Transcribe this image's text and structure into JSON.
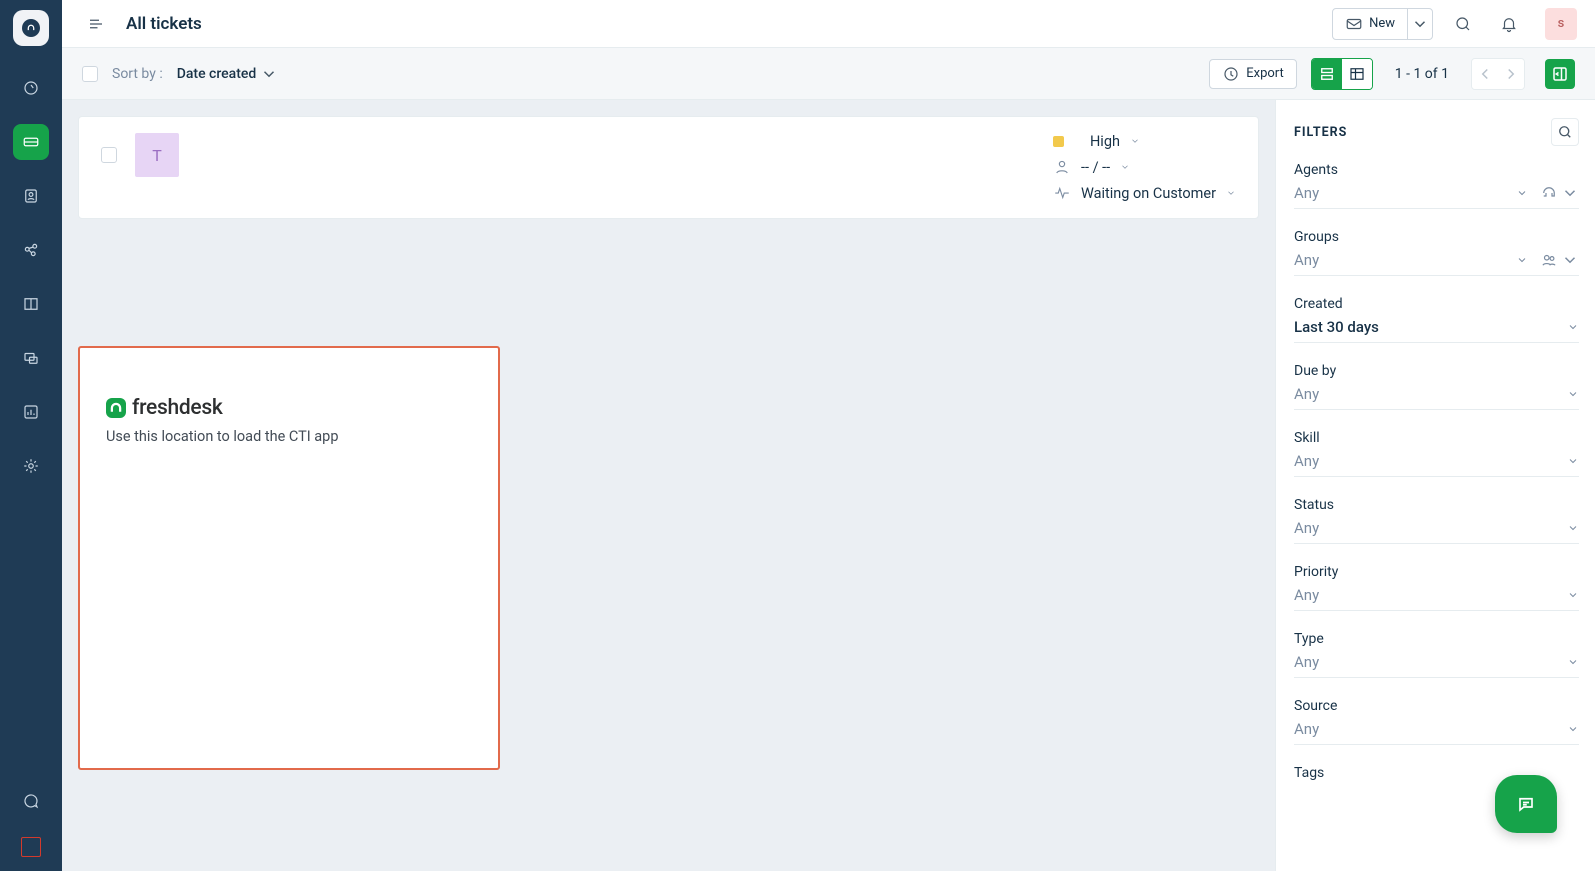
{
  "header": {
    "page_title": "All tickets",
    "new_label": "New",
    "avatar_letter": "s"
  },
  "toolbar": {
    "sort_label": "Sort by :",
    "sort_value": "Date created",
    "export_label": "Export",
    "pagination": "1 - 1 of 1"
  },
  "ticket": {
    "avatar_letter": "T",
    "priority": "High",
    "assignee": "-- / --",
    "status": "Waiting on Customer"
  },
  "cti": {
    "brand": "freshdesk",
    "description": "Use this location to load the CTI app"
  },
  "filters": {
    "title": "FILTERS",
    "any": "Any",
    "blocks": {
      "agents": {
        "label": "Agents",
        "value": "Any",
        "selected": false,
        "extra_icon": "headset"
      },
      "groups": {
        "label": "Groups",
        "value": "Any",
        "selected": false,
        "extra_icon": "people"
      },
      "created": {
        "label": "Created",
        "value": "Last 30 days",
        "selected": true
      },
      "due_by": {
        "label": "Due by",
        "value": "Any",
        "selected": false
      },
      "skill": {
        "label": "Skill",
        "value": "Any",
        "selected": false
      },
      "status": {
        "label": "Status",
        "value": "Any",
        "selected": false
      },
      "priority": {
        "label": "Priority",
        "value": "Any",
        "selected": false
      },
      "type": {
        "label": "Type",
        "value": "Any",
        "selected": false
      },
      "source": {
        "label": "Source",
        "value": "Any",
        "selected": false
      },
      "tags": {
        "label": "Tags"
      }
    }
  }
}
